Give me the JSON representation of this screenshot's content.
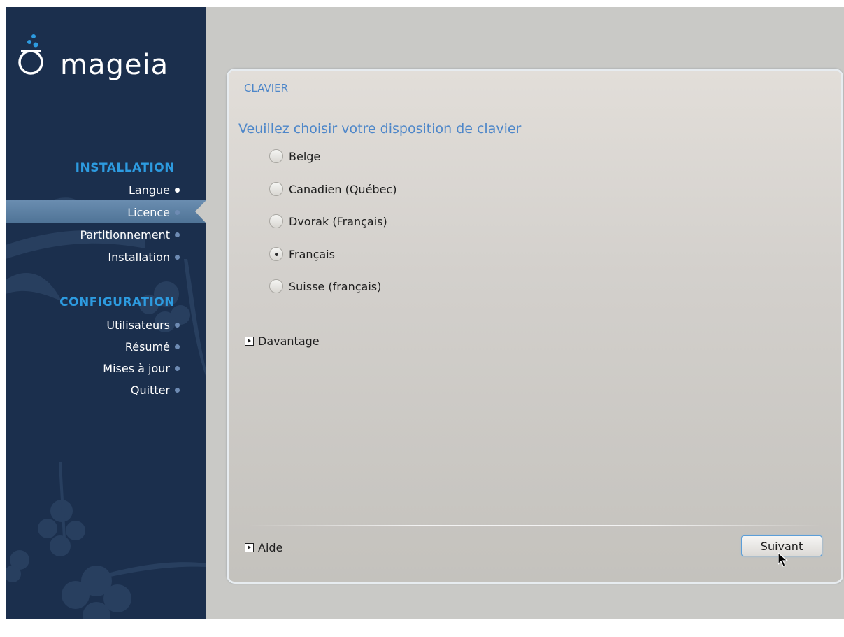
{
  "brand": {
    "logo_text": "mageia"
  },
  "sidebar": {
    "sections": [
      {
        "heading": "INSTALLATION",
        "items": [
          {
            "label": "Langue",
            "state": "done"
          },
          {
            "label": "Licence",
            "state": "current"
          },
          {
            "label": "Partitionnement",
            "state": "pending"
          },
          {
            "label": "Installation",
            "state": "pending"
          }
        ]
      },
      {
        "heading": "CONFIGURATION",
        "items": [
          {
            "label": "Utilisateurs",
            "state": "pending"
          },
          {
            "label": "Résumé",
            "state": "pending"
          },
          {
            "label": "Mises à jour",
            "state": "pending"
          },
          {
            "label": "Quitter",
            "state": "pending"
          }
        ]
      }
    ]
  },
  "main": {
    "section_title": "CLAVIER",
    "question": "Veuillez choisir votre disposition de clavier",
    "options": [
      {
        "label": "Belge",
        "selected": false
      },
      {
        "label": "Canadien (Québec)",
        "selected": false
      },
      {
        "label": "Dvorak (Français)",
        "selected": false
      },
      {
        "label": "Français",
        "selected": true
      },
      {
        "label": "Suisse (français)",
        "selected": false
      }
    ],
    "more_label": "Davantage",
    "help_label": "Aide",
    "next_label": "Suivant"
  },
  "colors": {
    "sidebar_bg": "#1b2f4d",
    "accent_blue": "#2d9be0",
    "title_blue": "#4d86c9",
    "panel_bg": "#c4c2bd"
  }
}
